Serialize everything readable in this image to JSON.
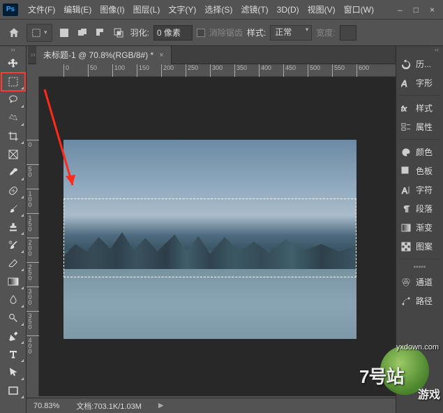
{
  "menu": {
    "items": [
      "文件(F)",
      "编辑(E)",
      "图像(I)",
      "图层(L)",
      "文字(Y)",
      "选择(S)",
      "滤镜(T)",
      "3D(D)",
      "视图(V)",
      "窗口(W)"
    ]
  },
  "window_controls": {
    "min": "–",
    "max": "□",
    "close": "×"
  },
  "options": {
    "feather_label": "羽化:",
    "feather_value": "0 像素",
    "antialias_label": "消除锯齿",
    "style_label": "样式:",
    "style_value": "正常",
    "width_label": "宽度:"
  },
  "tab": {
    "title": "未标题-1 @ 70.8%(RGB/8#) *"
  },
  "ruler_h": [
    "0",
    "50",
    "100",
    "150",
    "200",
    "250",
    "300",
    "350",
    "400",
    "450",
    "500",
    "550",
    "600"
  ],
  "ruler_v": [
    "0",
    "50",
    "100",
    "150",
    "200",
    "250",
    "300",
    "350",
    "400"
  ],
  "status": {
    "zoom": "70.83%",
    "doc_label": "文档:",
    "doc_value": "703.1K/1.03M"
  },
  "right_panels_a": [
    {
      "name": "history",
      "label": "历..."
    },
    {
      "name": "glyphs",
      "label": "字形"
    },
    {
      "name": "styles",
      "label": "样式"
    },
    {
      "name": "properties",
      "label": "属性"
    },
    {
      "name": "color",
      "label": "颜色"
    },
    {
      "name": "swatches",
      "label": "色板"
    },
    {
      "name": "character",
      "label": "字符"
    },
    {
      "name": "paragraph",
      "label": "段落"
    },
    {
      "name": "gradients",
      "label": "渐变"
    },
    {
      "name": "patterns",
      "label": "图案"
    }
  ],
  "right_panels_b": [
    {
      "name": "channels",
      "label": "通道"
    },
    {
      "name": "paths",
      "label": "路径"
    }
  ],
  "chart_data": {
    "type": "screenshot",
    "note": "not a chart"
  },
  "watermark": {
    "main": "7号站",
    "sub": "游戏",
    "url": "yxdown.com"
  }
}
